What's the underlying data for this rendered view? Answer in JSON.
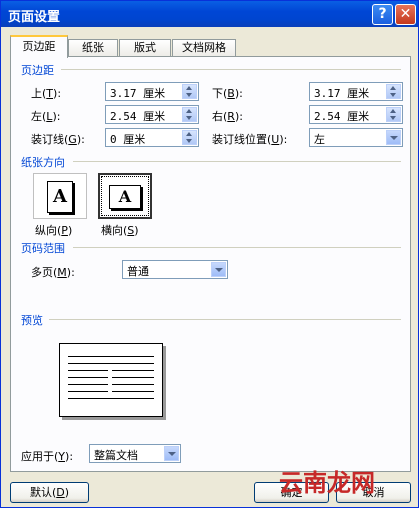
{
  "window": {
    "title": "页面设置",
    "help_glyph": "?",
    "close_glyph": "✕"
  },
  "tabs": [
    "页边距",
    "纸张",
    "版式",
    "文档网格"
  ],
  "margins": {
    "group_label": "页边距",
    "top_label": "上(",
    "top_key": "T",
    "top_value": "3.17 厘米",
    "bottom_label": "下(",
    "bottom_key": "B",
    "bottom_value": "3.17 厘米",
    "left_label": "左(",
    "left_key": "L",
    "left_value": "2.54 厘米",
    "right_label": "右(",
    "right_key": "R",
    "right_value": "2.54 厘米",
    "gutter_label": "装订线(",
    "gutter_key": "G",
    "gutter_value": "0 厘米",
    "gutter_pos_label": "装订线位置(",
    "gutter_pos_key": "U",
    "gutter_pos_value": "左"
  },
  "orientation": {
    "group_label": "纸张方向",
    "portrait_label": "纵向(",
    "portrait_key": "P",
    "landscape_label": "横向(",
    "landscape_key": "S",
    "glyph": "A"
  },
  "pages": {
    "group_label": "页码范围",
    "multi_label": "多页(",
    "multi_key": "M",
    "multi_value": "普通"
  },
  "preview": {
    "group_label": "预览"
  },
  "apply": {
    "label": "应用于(",
    "key": "Y",
    "value": "整篇文档"
  },
  "buttons": {
    "default_label": "默认(",
    "default_key": "D",
    "ok": "确定",
    "cancel": "取消"
  },
  "watermark": "云南龙网",
  "paren_close": ")",
  "colon": ":"
}
